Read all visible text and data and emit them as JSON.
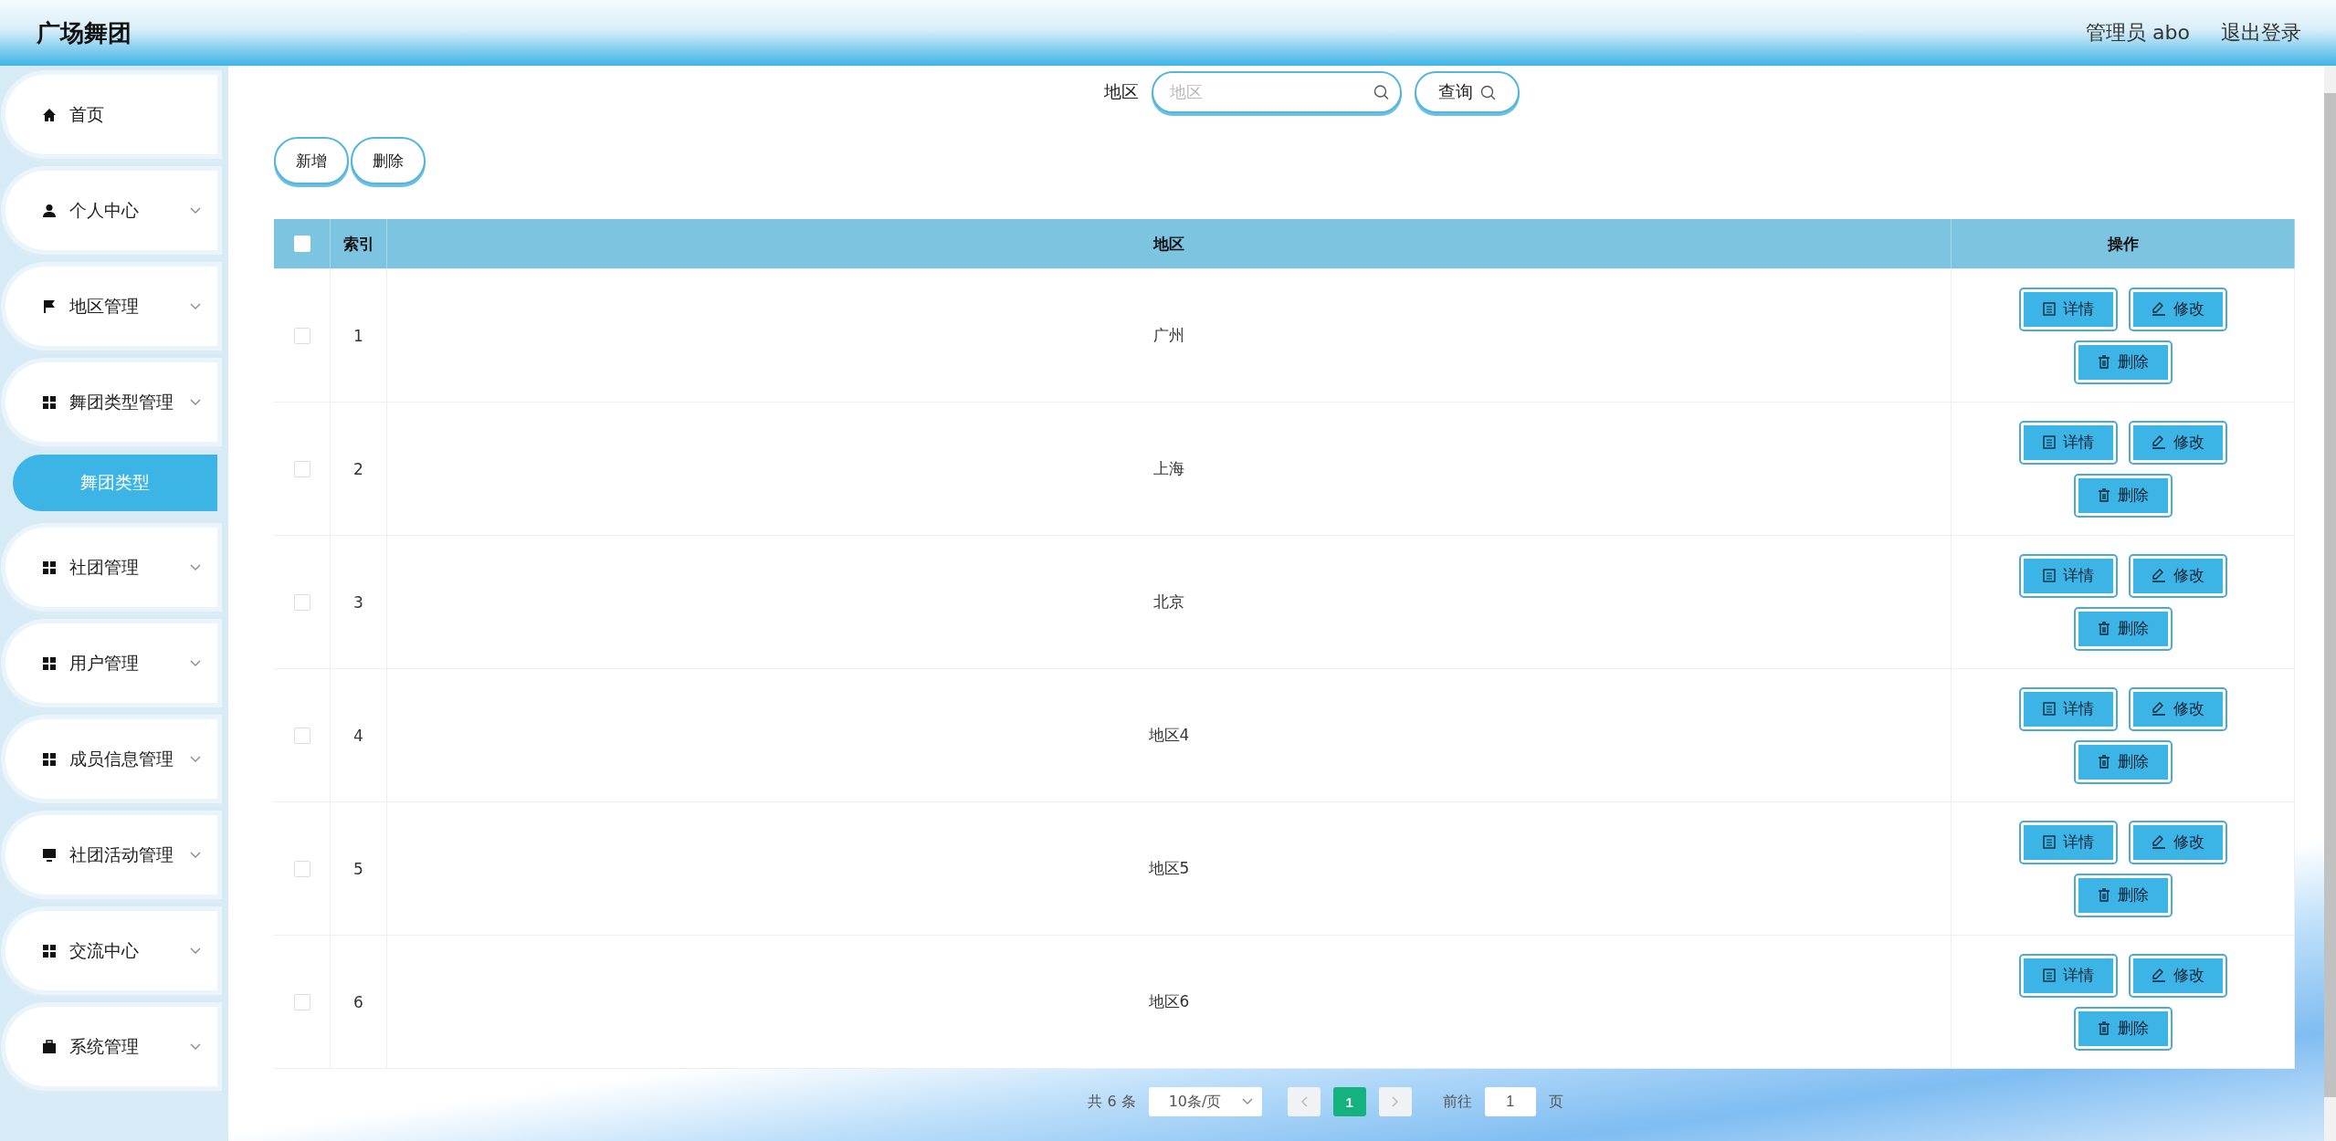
{
  "header": {
    "title": "广场舞团",
    "user": "管理员 abo",
    "logout": "退出登录"
  },
  "sidebar": {
    "items": [
      {
        "label": "首页",
        "kind": "link",
        "selected": false
      },
      {
        "label": "个人中心",
        "kind": "menu",
        "selected": false
      },
      {
        "label": "地区管理",
        "kind": "menu",
        "selected": false
      },
      {
        "label": "舞团类型管理",
        "kind": "menu",
        "selected": false,
        "children": [
          {
            "label": "舞团类型",
            "selected": true
          }
        ]
      },
      {
        "label": "社团管理",
        "kind": "menu",
        "selected": false
      },
      {
        "label": "用户管理",
        "kind": "menu",
        "selected": false
      },
      {
        "label": "成员信息管理",
        "kind": "menu",
        "selected": false
      },
      {
        "label": "社团活动管理",
        "kind": "menu",
        "selected": false
      },
      {
        "label": "交流中心",
        "kind": "menu",
        "selected": false
      },
      {
        "label": "系统管理",
        "kind": "menu",
        "selected": false
      }
    ]
  },
  "search": {
    "label": "地区",
    "placeholder": "地区",
    "button": "查询"
  },
  "actions": [
    "新增",
    "删除"
  ],
  "table": {
    "header_checked": false,
    "columns": [
      "索引",
      "地区",
      "操作"
    ],
    "rows": [
      {
        "checked": false,
        "index": "1",
        "region": "广州",
        "buttons": [
          "详情",
          "修改",
          "删除"
        ]
      },
      {
        "checked": false,
        "index": "2",
        "region": "上海",
        "buttons": [
          "详情",
          "修改",
          "删除"
        ]
      },
      {
        "checked": false,
        "index": "3",
        "region": "北京",
        "buttons": [
          "详情",
          "修改",
          "删除"
        ]
      },
      {
        "checked": false,
        "index": "4",
        "region": "地区4",
        "buttons": [
          "详情",
          "修改",
          "删除"
        ]
      },
      {
        "checked": false,
        "index": "5",
        "region": "地区5",
        "buttons": [
          "详情",
          "修改",
          "删除"
        ]
      },
      {
        "checked": false,
        "index": "6",
        "region": "地区6",
        "buttons": [
          "详情",
          "修改",
          "删除"
        ]
      }
    ]
  },
  "pagination": {
    "total": "共 6 条",
    "page_size": "10条/页",
    "pages": [
      {
        "label": "1",
        "selected": true
      }
    ],
    "goto_label": "前往",
    "goto_value": "1",
    "goto_suffix": "页"
  }
}
